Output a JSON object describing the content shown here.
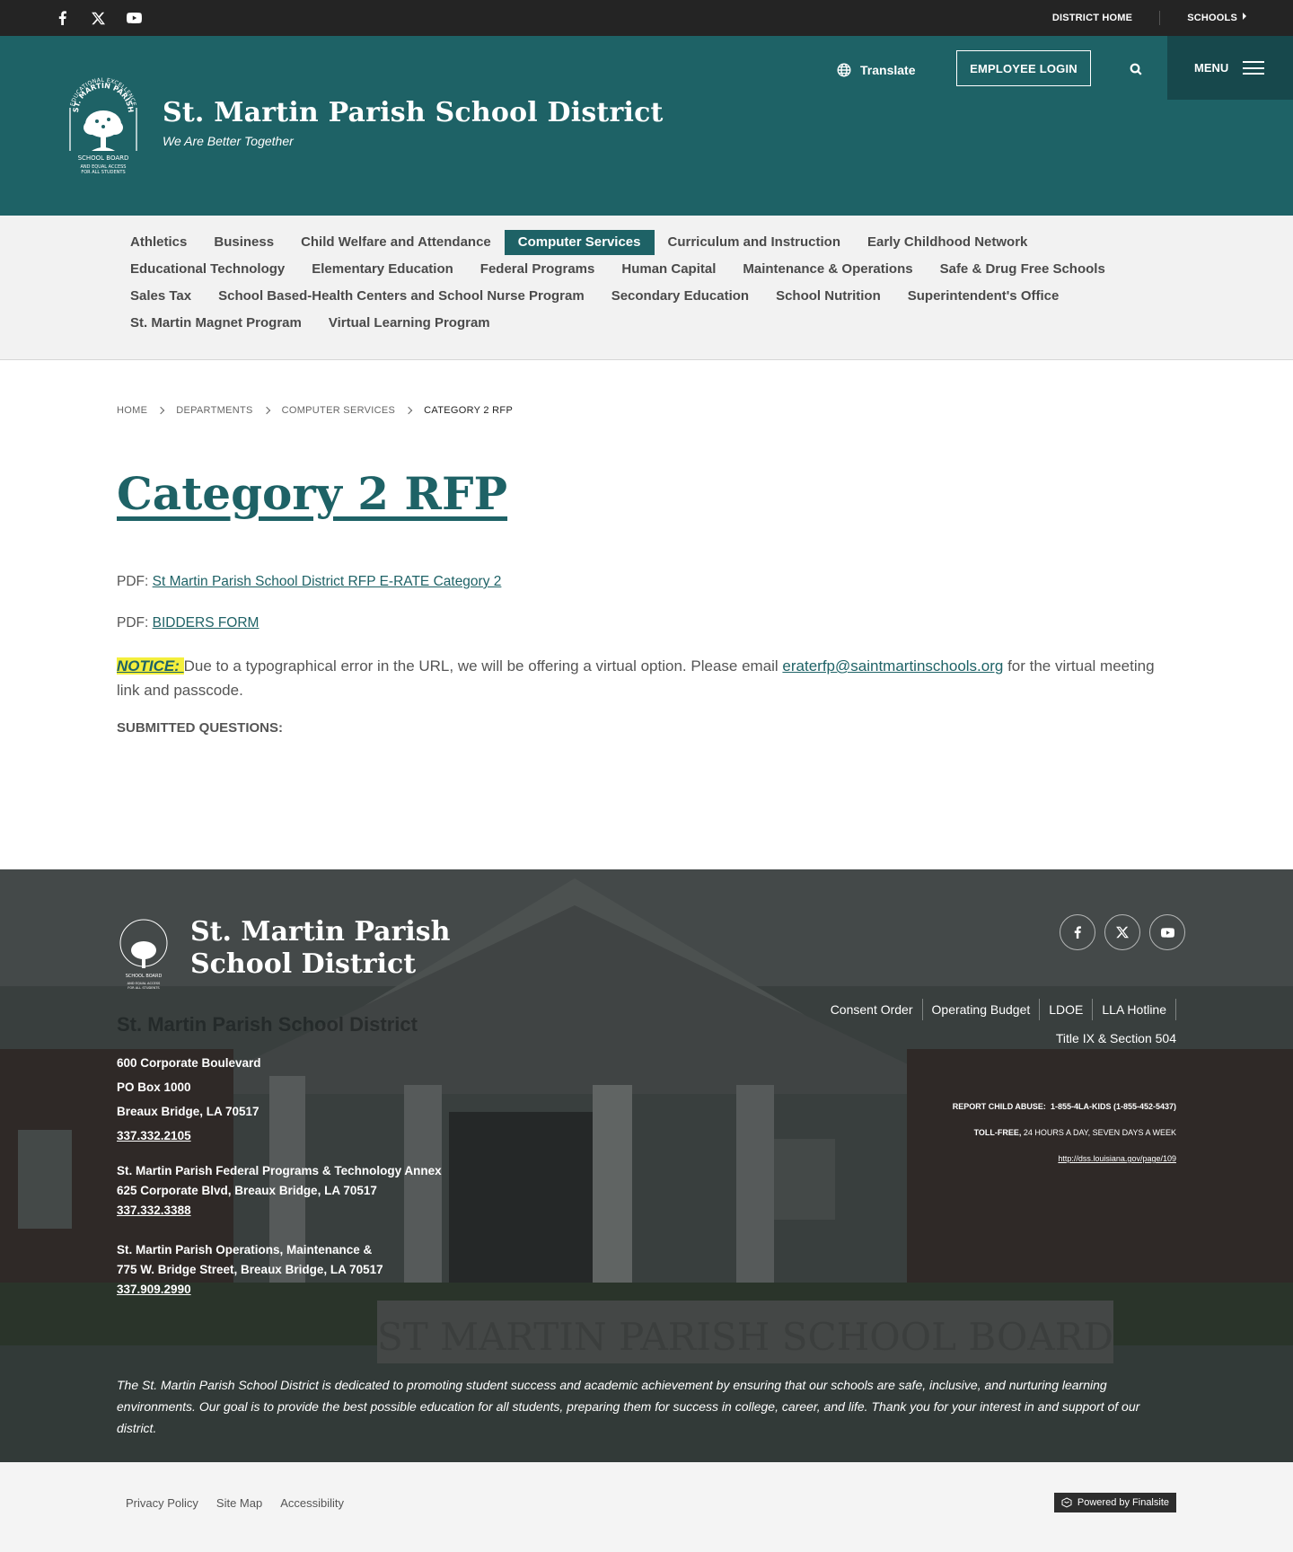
{
  "utility": {
    "social": [
      {
        "icon": "facebook-icon"
      },
      {
        "icon": "x-twitter-icon"
      },
      {
        "icon": "youtube-icon"
      }
    ],
    "district_home": "DISTRICT HOME",
    "schools": "SCHOOLS"
  },
  "header": {
    "site_name": "St. Martin Parish School District",
    "tagline": "We Are Better Together",
    "translate": "Translate",
    "employee_login": "EMPLOYEE LOGIN",
    "menu": "MENU",
    "logo_text": {
      "arc": "EDUCATIONAL EXCELLENCE",
      "name": "ST. MARTIN PARISH",
      "board": "SCHOOL BOARD",
      "line1": "AND EQUAL ACCESS",
      "line2": "FOR ALL STUDENTS"
    }
  },
  "departments": [
    {
      "label": "Athletics",
      "active": false
    },
    {
      "label": "Business",
      "active": false
    },
    {
      "label": "Child Welfare and Attendance",
      "active": false
    },
    {
      "label": "Computer Services",
      "active": true
    },
    {
      "label": "Curriculum and Instruction",
      "active": false
    },
    {
      "label": "Early Childhood Network",
      "active": false
    },
    {
      "label": "Educational Technology",
      "active": false
    },
    {
      "label": "Elementary Education",
      "active": false
    },
    {
      "label": "Federal Programs",
      "active": false
    },
    {
      "label": "Human Capital",
      "active": false
    },
    {
      "label": "Maintenance & Operations",
      "active": false
    },
    {
      "label": "Safe & Drug Free Schools",
      "active": false
    },
    {
      "label": "Sales Tax",
      "active": false
    },
    {
      "label": "School Based-Health Centers and School Nurse Program",
      "active": false
    },
    {
      "label": "Secondary Education",
      "active": false
    },
    {
      "label": "School Nutrition",
      "active": false
    },
    {
      "label": "Superintendent's Office",
      "active": false
    },
    {
      "label": "St. Martin Magnet Program",
      "active": false
    },
    {
      "label": "Virtual Learning Program",
      "active": false
    }
  ],
  "breadcrumb": [
    "HOME",
    "DEPARTMENTS",
    "COMPUTER SERVICES",
    "CATEGORY 2 RFP"
  ],
  "content": {
    "title": "Category 2 RFP",
    "pdf_prefix": "PDF:",
    "pdf1": "St Martin Parish School District RFP E-RATE Category 2",
    "pdf2": "BIDDERS FORM",
    "notice_label": "NOTICE: ",
    "notice_text": "Due to a typographical error in the URL, we will be offering a virtual option. Please email ",
    "notice_email": "eraterfp@saintmartinschools.org",
    "notice_tail": " for the virtual meeting link and passcode.",
    "submitted": "SUBMITTED QUESTIONS:"
  },
  "footer": {
    "name": "St. Martin Parish School District",
    "ghost_text": "St. Martin Parish School District",
    "address": [
      "600 Corporate Boulevard",
      "PO Box 1000",
      "Breaux Bridge, LA  70517"
    ],
    "phone1": "337.332.2105",
    "annex_name": "St. Martin Parish Federal Programs & Technology Annex",
    "annex_addr": "625 Corporate Blvd, Breaux Bridge, LA  70517",
    "phone2": "337.332.3388",
    "ops_name": "St. Martin Parish Operations, Maintenance &",
    "ops_addr": "775 W. Bridge Street, Breaux Bridge, LA  70517",
    "phone3": "337.909.2990",
    "links": [
      "Consent Order",
      "Operating Budget",
      "LDOE",
      "LLA Hotline",
      "Title IX & Section 504"
    ],
    "abuse_label": "REPORT CHILD ABUSE:",
    "abuse_number": "1-855-4LA-KIDS (1-855-452-5437)",
    "tollfree_label": "TOLL-FREE,",
    "tollfree_text": "24 HOURS A DAY, SEVEN DAYS A WEEK",
    "dss_link": "http://dss.louisiana.gov/page/109",
    "mission": "The St. Martin Parish School District is dedicated to promoting student success and academic achievement by ensuring that our schools are safe, inclusive, and nurturing learning environments. Our goal is to provide the best possible education for all students, preparing them for success in college, career, and life. Thank you for your interest in and support of our district.",
    "bg_sign_text": "ST MARTIN PARISH SCHOOL BOARD"
  },
  "bottom": {
    "links": [
      "Privacy Policy",
      "Site Map",
      "Accessibility"
    ],
    "powered": "Powered by Finalsite"
  },
  "colors": {
    "brand_teal": "#1e6266",
    "menu_dark": "#17484c",
    "notice_highlight": "#f4ef3c",
    "utility_bar": "#242424"
  }
}
